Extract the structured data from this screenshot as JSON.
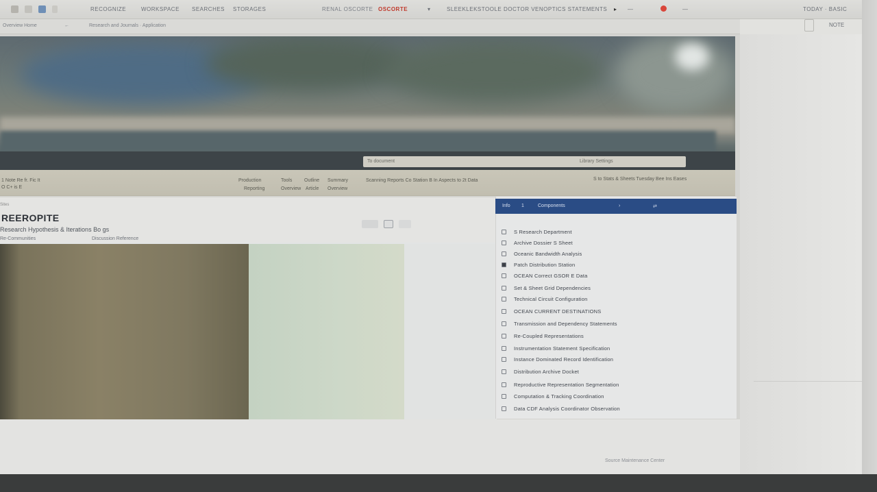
{
  "toolbar": {
    "items": [
      "RECOGNIZE",
      "WORKSPACE",
      "SEARCHES",
      "STORAGES"
    ],
    "center_label": "RENAL OSCORTE",
    "center_accent": "OSCORTE",
    "search_text": "SLEEKLEKSTOOLE DOCTOR VENOPTICS STATEMENTS",
    "right_label": "NOTE",
    "right_meta": "TODAY · BASIC",
    "accent_color": "#c0392b",
    "icons": [
      "gear-icon",
      "grid-icon",
      "bookmark-icon",
      "refresh-icon",
      "flag-icon"
    ]
  },
  "sub_toolbar": {
    "left": "Overview  Home",
    "path": "Research and Journals · Application"
  },
  "hero": {
    "bar_left": "To document",
    "bar_right": "Library  Settings"
  },
  "strip": {
    "left_line1": "1 Note Re fr. Fic It",
    "left_line2": "O C+ is E",
    "tabs": [
      "Production",
      "Tools",
      "Outline",
      "Summary"
    ],
    "tabs_sub": [
      "Reporting",
      "Overview",
      "Article",
      "Overview"
    ],
    "center": "Scanning Reports Co Station B In Aspects to 2t Data",
    "right": "S to Stats & Sheets Tuesday Bee Ins Eases"
  },
  "article": {
    "breadcrumb": "Sites",
    "title": "REEROPITE",
    "subtitle": "Research Hypothesis & Iterations Bo gs",
    "meta_left": "Re-Communities",
    "meta_right": "Discussion Reference"
  },
  "panel": {
    "header_a": "Info",
    "header_b": "1",
    "header_title": "Components",
    "header_c": "",
    "items": [
      "S Research Department",
      "Archive Dossier S Sheet",
      "Oceanic Bandwidth Analysis",
      "Patch Distribution Station",
      "OCEAN Correct GSOR E Data",
      "Set & Sheet Grid Dependencies",
      "Technical Circuit Configuration",
      "OCEAN CURRENT DESTINATIONS",
      "Transmission and Dependency Statements",
      "Re-Coupled Representations",
      "Instrumentation Statement Specification",
      "Instance Dominated Record Identification",
      "Distribution Archive Docket",
      "Reproductive Representation Segmentation",
      "Computation & Tracking Coordination",
      "Data CDF Analysis Coordinator Observation"
    ]
  },
  "footer": {
    "text": "Source Maintenance Center"
  }
}
